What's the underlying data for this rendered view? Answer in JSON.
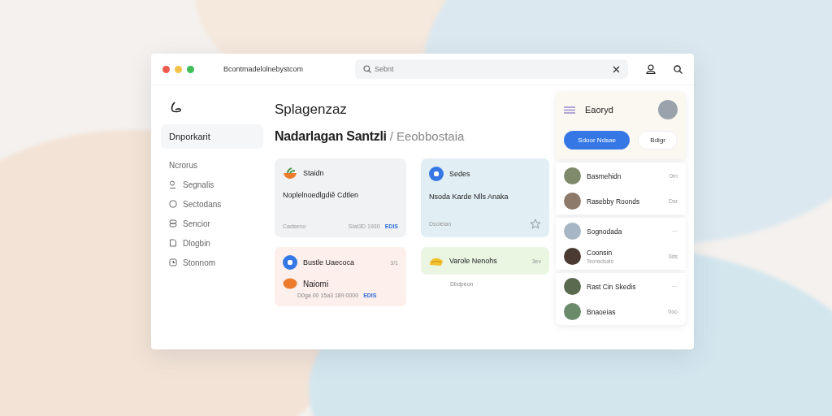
{
  "window": {
    "title": "Bcontmadelolnebystcom",
    "search": {
      "placeholder": "Sebnt"
    }
  },
  "sidebar": {
    "items": [
      {
        "label": "Dnporkarit",
        "kind": "text",
        "selected": true
      },
      {
        "label": "Ncrorus",
        "kind": "text",
        "selected": false
      },
      {
        "label": "Segnalis",
        "kind": "icon",
        "selected": false
      },
      {
        "label": "Sectodans",
        "kind": "icon",
        "selected": false
      },
      {
        "label": "Sencior",
        "kind": "icon",
        "selected": false
      },
      {
        "label": "Dlogbin",
        "kind": "icon",
        "selected": false
      },
      {
        "label": "Stonnom",
        "kind": "icon",
        "selected": false
      }
    ]
  },
  "main": {
    "title": "Splagenzaz",
    "subtitle": "Nadarlagan Santzli",
    "separator": "/",
    "crumb": "Eeobbostaia",
    "cards": [
      {
        "kind": "note",
        "color": "#f1f2f4",
        "title": "Staidn",
        "body": "Noplelnoedlgdiě Cdtlen",
        "footer": "Cadseno",
        "meta": "SIat3D 1930",
        "tag": "EDIS"
      },
      {
        "kind": "note",
        "color": "#e1eff4",
        "title": "Sedes",
        "body": "Nsoda Karde Nlls Anaka",
        "footer": "Dsolelan",
        "star": true
      },
      {
        "kind": "pair",
        "color": "#fcefec",
        "title": "Bustle Uaecoca",
        "time": "3/1",
        "sub_title": "Naiomi",
        "sub_meta": "D0ga 00 15a3 189 0000",
        "tag": "EDIS"
      },
      {
        "kind": "strip",
        "color": "#eaf5e2",
        "title": "Varole Nenohs",
        "time": "3ev",
        "caption": "Dbdpeon"
      }
    ]
  },
  "panel": {
    "title": "Eaoryd",
    "buttons": [
      {
        "label": "Sdoor Ndsae",
        "kind": "primary"
      },
      {
        "label": "Bdigr",
        "kind": "plain"
      }
    ],
    "groups": [
      [
        {
          "name": "Basmehidn",
          "meta": "0rn"
        },
        {
          "name": "Rasebby Roonds",
          "meta": "Dsr"
        }
      ],
      [
        {
          "name": "Sognodada",
          "meta": "···"
        },
        {
          "name": "Coonsin",
          "sub": "Teonsdsats",
          "meta": "0ds"
        }
      ],
      [
        {
          "name": "Rast Cin Skedis",
          "meta": "···"
        },
        {
          "name": "Bnaoeias",
          "meta": "0oo"
        }
      ]
    ]
  }
}
